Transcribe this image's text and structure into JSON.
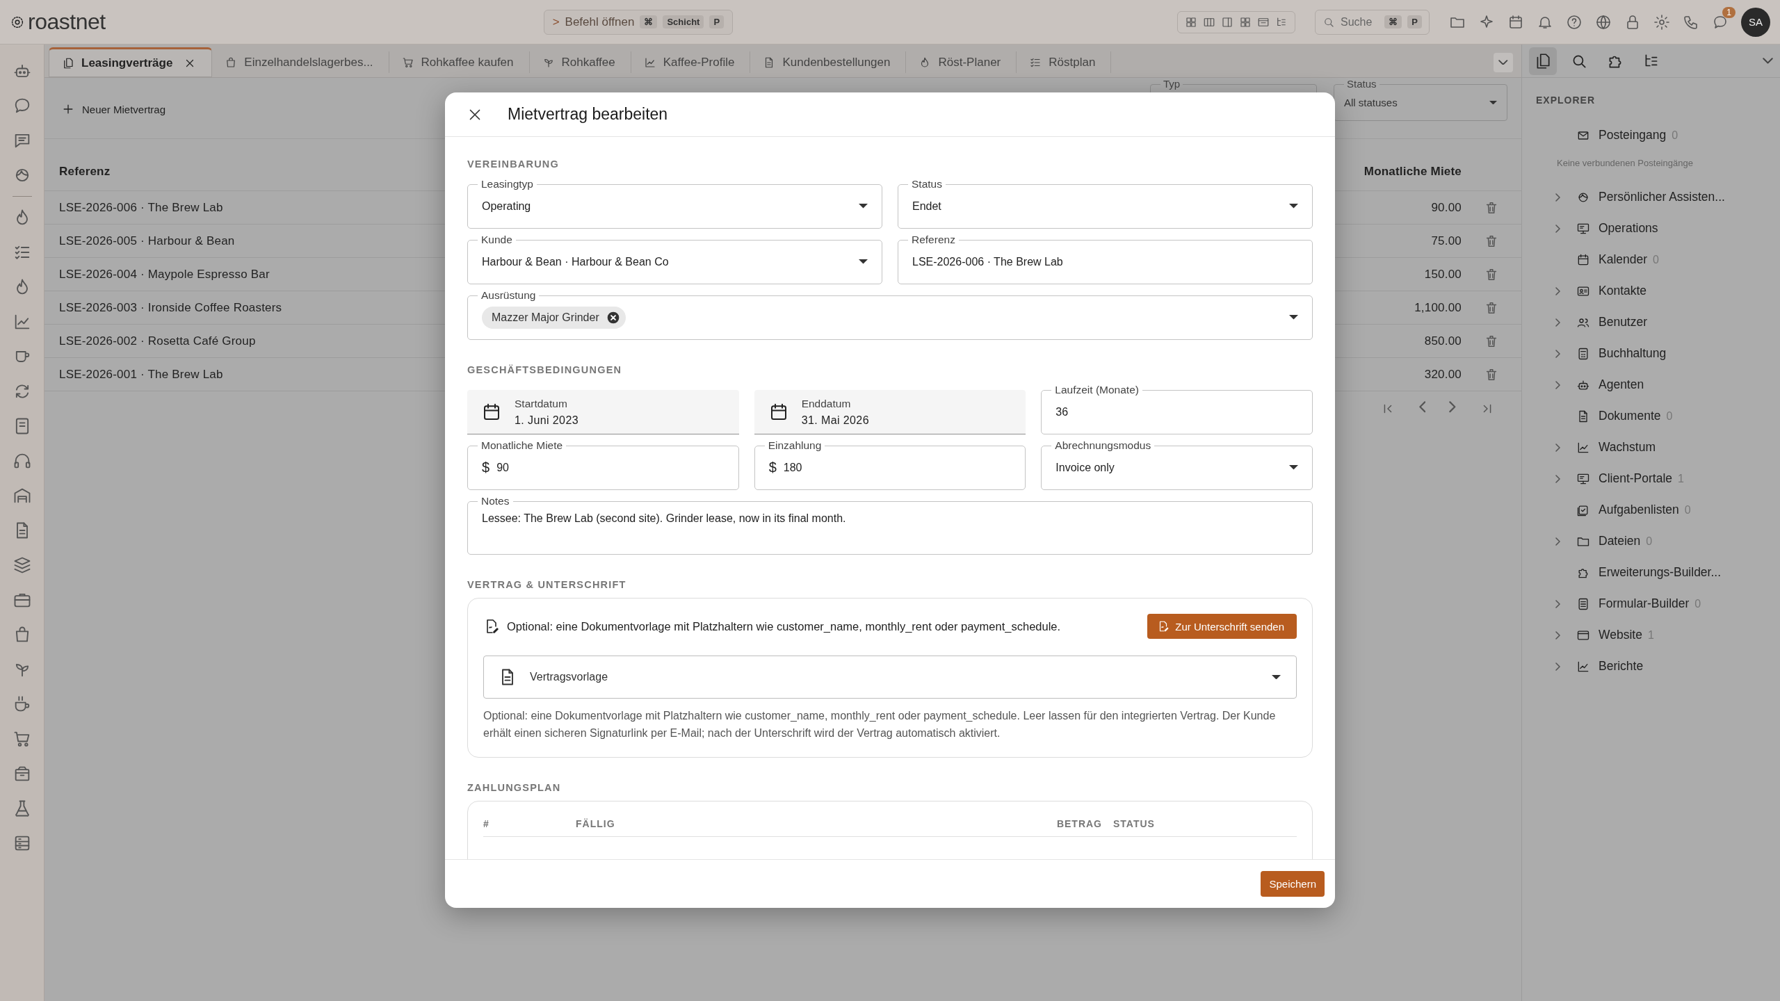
{
  "app": {
    "logo": "roastnet"
  },
  "command": {
    "prompt": ">",
    "label": "Befehl öffnen",
    "keys": [
      "⌘",
      "Schicht",
      "P"
    ]
  },
  "search": {
    "label": "Suche",
    "keys": [
      "⌘",
      "P"
    ]
  },
  "chat_badge": "1",
  "avatar": "SA",
  "tabs": [
    {
      "label": "Leasingverträge",
      "selected": true
    },
    {
      "label": "Einzelhandelslagerbes...",
      "selected": false
    },
    {
      "label": "Rohkaffee kaufen",
      "selected": false
    },
    {
      "label": "Rohkaffee",
      "selected": false
    },
    {
      "label": "Kaffee-Profile",
      "selected": false
    },
    {
      "label": "Kundenbestellungen",
      "selected": false
    },
    {
      "label": "Röst-Planer",
      "selected": false
    },
    {
      "label": "Röstplan",
      "selected": false
    }
  ],
  "toolbar": {
    "new_button": "Neuer Mietvertrag"
  },
  "filters": [
    {
      "label": "Typ"
    },
    {
      "label": "Status",
      "value": "All statuses"
    }
  ],
  "table": {
    "columns": [
      "Referenz",
      "Monatliche Miete"
    ],
    "rows": [
      {
        "reference": "LSE-2026-006 · The Brew Lab",
        "monthly_rent": "90.00"
      },
      {
        "reference": "LSE-2026-005 · Harbour & Bean",
        "monthly_rent": "75.00"
      },
      {
        "reference": "LSE-2026-004 · Maypole Espresso Bar",
        "monthly_rent": "150.00"
      },
      {
        "reference": "LSE-2026-003 · Ironside Coffee Roasters",
        "monthly_rent": "1,100.00"
      },
      {
        "reference": "LSE-2026-002 · Rosetta Café Group",
        "monthly_rent": "850.00"
      },
      {
        "reference": "LSE-2026-001 · The Brew Lab",
        "monthly_rent": "320.00"
      }
    ]
  },
  "explorer": {
    "title": "EXPLORER",
    "items": [
      {
        "kind": "item",
        "label": "Posteingang",
        "count": "0",
        "expandable": false
      },
      {
        "kind": "note",
        "label": "Keine verbundenen Posteingänge"
      },
      {
        "kind": "item",
        "label": "Persönlicher Assisten...",
        "expandable": true
      },
      {
        "kind": "item",
        "label": "Operations",
        "expandable": true
      },
      {
        "kind": "item",
        "label": "Kalender",
        "count": "0",
        "expandable": false
      },
      {
        "kind": "item",
        "label": "Kontakte",
        "expandable": true
      },
      {
        "kind": "item",
        "label": "Benutzer",
        "expandable": true
      },
      {
        "kind": "item",
        "label": "Buchhaltung",
        "expandable": true
      },
      {
        "kind": "item",
        "label": "Agenten",
        "expandable": true
      },
      {
        "kind": "item",
        "label": "Dokumente",
        "count": "0",
        "expandable": false
      },
      {
        "kind": "item",
        "label": "Wachstum",
        "expandable": true
      },
      {
        "kind": "item",
        "label": "Client-Portale",
        "count": "1",
        "expandable": true
      },
      {
        "kind": "item",
        "label": "Aufgabenlisten",
        "count": "0",
        "expandable": false
      },
      {
        "kind": "item",
        "label": "Dateien",
        "count": "0",
        "expandable": true
      },
      {
        "kind": "item",
        "label": "Erweiterungs-Builder...",
        "expandable": false
      },
      {
        "kind": "item",
        "label": "Formular-Builder",
        "count": "0",
        "expandable": true
      },
      {
        "kind": "item",
        "label": "Website",
        "count": "1",
        "expandable": true
      },
      {
        "kind": "item",
        "label": "Berichte",
        "expandable": true
      }
    ]
  },
  "dialog": {
    "title": "Mietvertrag bearbeiten",
    "agreement": {
      "heading": "VEREINBARUNG",
      "fields": [
        {
          "kind": "select",
          "label": "Leasingtyp",
          "value": "Operating"
        },
        {
          "kind": "select",
          "label": "Status",
          "value": "Endet"
        },
        {
          "kind": "select",
          "label": "Kunde",
          "value": "Harbour & Bean · Harbour & Bean Co"
        },
        {
          "kind": "text",
          "label": "Referenz",
          "value": "LSE-2026-006 · The Brew Lab"
        },
        {
          "kind": "chips",
          "label": "Ausrüstung",
          "chips": [
            "Mazzer Major Grinder"
          ]
        }
      ]
    },
    "terms": {
      "heading": "GESCHÄFTSBEDINGUNGEN",
      "fields": [
        {
          "kind": "date",
          "label": "Startdatum",
          "value": "1. Juni 2023"
        },
        {
          "kind": "date",
          "label": "Enddatum",
          "value": "31. Mai 2026"
        },
        {
          "kind": "text",
          "label": "Laufzeit (Monate)",
          "value": "36"
        },
        {
          "kind": "money",
          "label": "Monatliche Miete",
          "prefix": "$",
          "value": "90"
        },
        {
          "kind": "money",
          "label": "Einzahlung",
          "prefix": "$",
          "value": "180"
        },
        {
          "kind": "select",
          "label": "Abrechnungsmodus",
          "value": "Invoice only"
        },
        {
          "kind": "textarea",
          "label": "Notes",
          "value": "Lessee: The Brew Lab (second site). Grinder lease, now in its final month."
        }
      ]
    },
    "contract": {
      "heading": "VERTRAG & UNTERSCHRIFT",
      "info": "Optional: eine Dokumentvorlage mit Platzhaltern wie customer_name, monthly_rent oder payment_schedule.",
      "send_button": "Zur Unterschrift senden",
      "template": "Vertragsvorlage",
      "help": "Optional: eine Dokumentvorlage mit Platzhaltern wie customer_name, monthly_rent oder payment_schedule. Leer lassen für den integrierten Vertrag. Der Kunde erhält einen sicheren Signaturlink per E-Mail; nach der Unterschrift wird der Vertrag automatisch aktiviert."
    },
    "payment_plan": {
      "heading": "ZAHLUNGSPLAN",
      "columns": [
        "#",
        "FÄLLIG",
        "BETRAG",
        "STATUS"
      ]
    },
    "save_button": "Speichern"
  }
}
